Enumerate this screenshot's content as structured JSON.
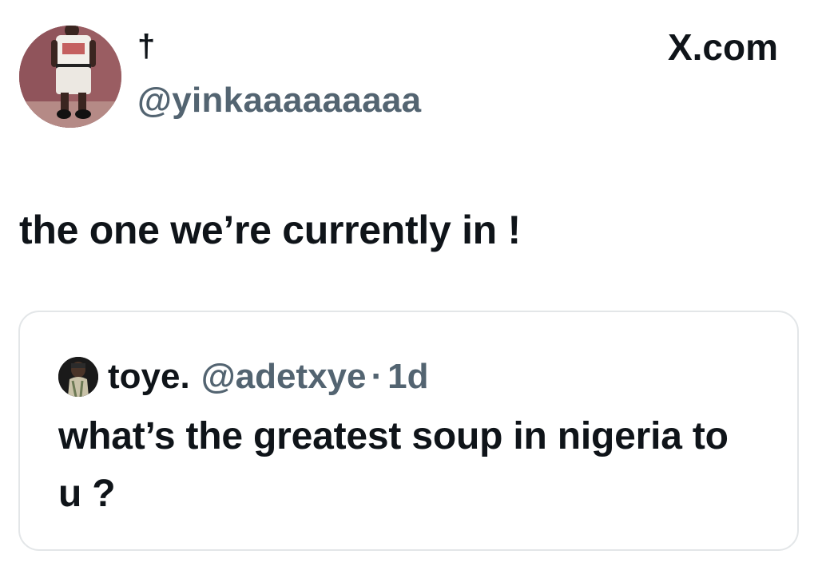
{
  "site": {
    "brand": "X.com",
    "logo_icon": "x-logo-icon"
  },
  "author": {
    "display_name": "†",
    "handle": "@yinkaaaaaaaaa",
    "avatar_icon": "avatar-photo"
  },
  "tweet": {
    "text": "the one we’re currently in !"
  },
  "quoted_tweet": {
    "author_name": "toye.",
    "author_handle": "@adetxye",
    "separator": "·",
    "time_ago": "1d",
    "text": "what’s the greatest soup in nigeria to u ?",
    "avatar_icon": "avatar-photo"
  },
  "colors": {
    "text_primary": "#0f1419",
    "text_secondary": "#536471",
    "card_border": "#e3e6e8",
    "background": "#ffffff"
  }
}
